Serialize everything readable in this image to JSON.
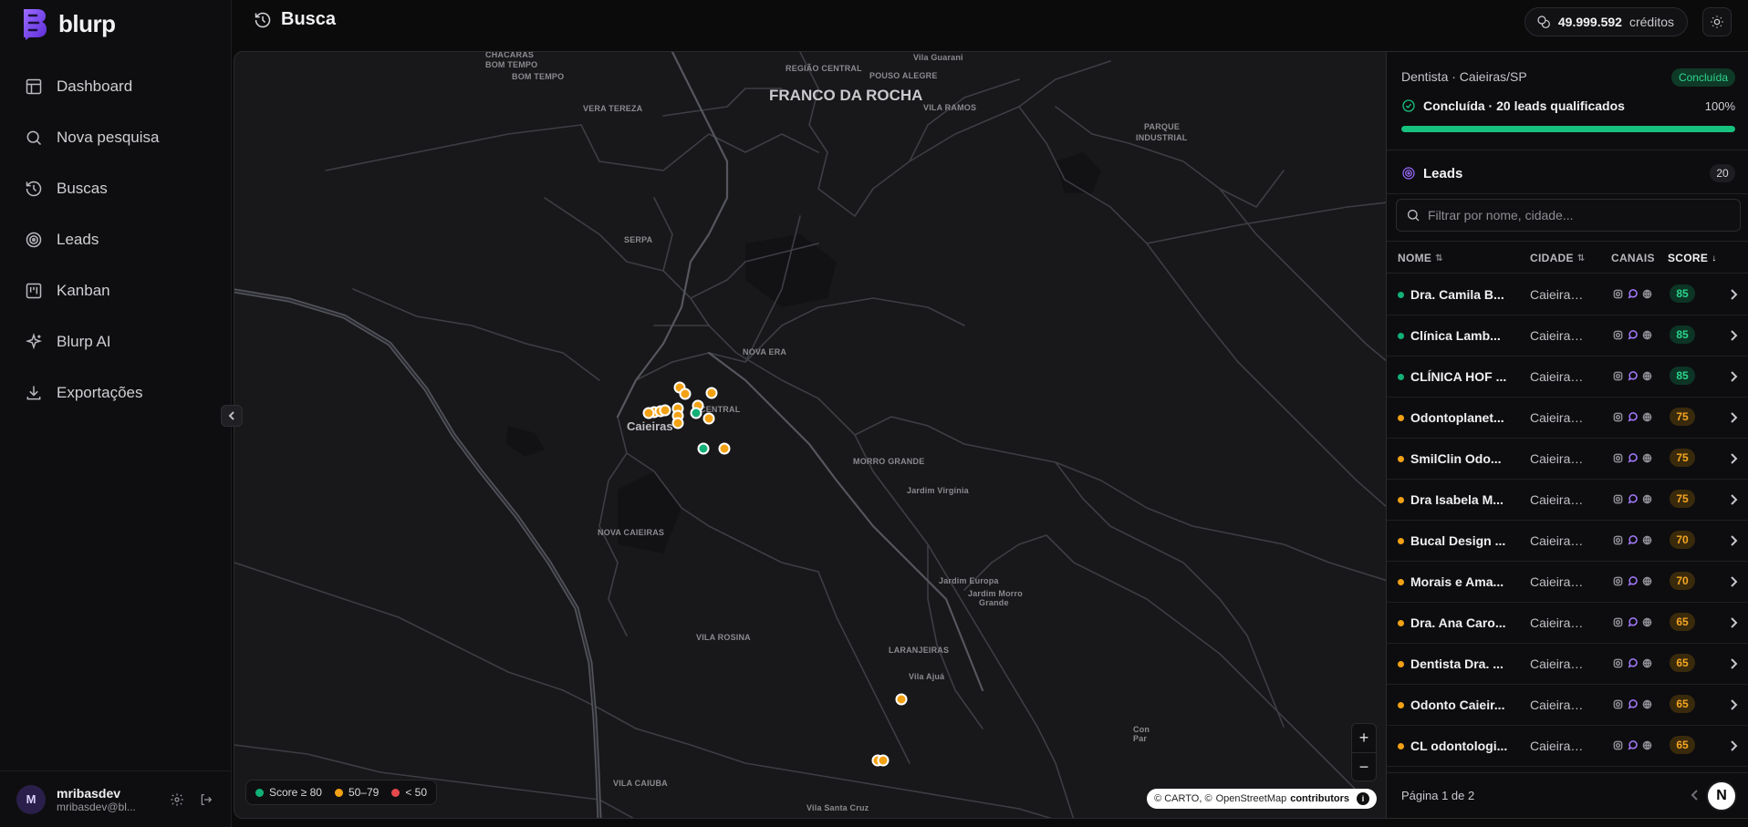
{
  "app": {
    "name": "blurp"
  },
  "sidebar": {
    "items": [
      {
        "label": "Dashboard",
        "icon": "dashboard-icon"
      },
      {
        "label": "Nova pesquisa",
        "icon": "search-icon"
      },
      {
        "label": "Buscas",
        "icon": "history-icon"
      },
      {
        "label": "Leads",
        "icon": "target-icon"
      },
      {
        "label": "Kanban",
        "icon": "kanban-icon"
      },
      {
        "label": "Blurp AI",
        "icon": "sparkles-icon"
      },
      {
        "label": "Exportações",
        "icon": "download-icon"
      }
    ]
  },
  "user": {
    "initial": "M",
    "name": "mribasdev",
    "email": "mribasdev@bl..."
  },
  "header": {
    "title": "Busca",
    "credits_amount": "49.999.592",
    "credits_label": "créditos"
  },
  "map": {
    "labels_large": [
      "FRANCO DA ROCHA"
    ],
    "labels_medium": [
      "Caieiras"
    ],
    "labels_small": [
      "CHÁCARAS",
      "BOM TEMPO",
      "BOM TEMPO",
      "VERA TEREZA",
      "REGIÃO CENTRAL",
      "POUSO ALEGRE",
      "Vila Guarani",
      "VILA RAMOS",
      "PARQUE",
      "INDUSTRIAL",
      "SERPA",
      "NOVA ERA",
      "CENTRAL",
      "MORRO GRANDE",
      "Jardim Virgínia",
      "NOVA CAIEIRAS",
      "Jardim Europa",
      "Jardim Morro",
      "Grande",
      "VILA ROSINA",
      "LARANJEIRAS",
      "Vila Ajuá",
      "VILA CAIUBA",
      "Vila Santa Cruz",
      "Con",
      "Par"
    ],
    "legend": [
      {
        "label": "Score ≥ 80",
        "color": "#12b076"
      },
      {
        "label": "50–79",
        "color": "#f3a114"
      },
      {
        "label": "< 50",
        "color": "#e5484d"
      }
    ],
    "zoom_in": "+",
    "zoom_out": "−",
    "attribution": {
      "carto": "© CARTO, ©",
      "osm": "OpenStreetMap",
      "contributors": "contributors",
      "info": "i"
    }
  },
  "panel": {
    "search_meta": "Dentista · Caieiras/SP",
    "status_badge": "Concluída",
    "progress_text": "Concluída · 20 leads qualificados",
    "progress_pct": "100%",
    "progress_value": 1.0,
    "leads_title": "Leads",
    "leads_count": "20",
    "filter_placeholder": "Filtrar por nome, cidade...",
    "columns": {
      "name": "NOME",
      "city": "CIDADE",
      "channels": "CANAIS",
      "score": "SCORE"
    },
    "rows": [
      {
        "name": "Dra. Camila B...",
        "city": "Caieiras/SP",
        "score": "85",
        "level": "hi"
      },
      {
        "name": "Clínica Lamb...",
        "city": "Caieiras/SP",
        "score": "85",
        "level": "hi"
      },
      {
        "name": "CLÍNICA HOF ...",
        "city": "Caieiras/SP",
        "score": "85",
        "level": "hi"
      },
      {
        "name": "Odontoplanet...",
        "city": "Caieiras/SP",
        "score": "75",
        "level": "mid"
      },
      {
        "name": "SmilClin Odo...",
        "city": "Caieiras/SP",
        "score": "75",
        "level": "mid"
      },
      {
        "name": "Dra Isabela M...",
        "city": "Caieiras/SP",
        "score": "75",
        "level": "mid"
      },
      {
        "name": "Bucal Design ...",
        "city": "Caieiras/SP",
        "score": "70",
        "level": "mid"
      },
      {
        "name": "Morais e Ama...",
        "city": "Caieiras/SP",
        "score": "70",
        "level": "mid"
      },
      {
        "name": "Dra. Ana Caro...",
        "city": "Caieiras/SP",
        "score": "65",
        "level": "mid"
      },
      {
        "name": "Dentista Dra. ...",
        "city": "Caieiras/SP",
        "score": "65",
        "level": "mid"
      },
      {
        "name": "Odonto Caieir...",
        "city": "Caieiras/SP",
        "score": "65",
        "level": "mid"
      },
      {
        "name": "CL odontologi...",
        "city": "Caieiras/SP",
        "score": "65",
        "level": "mid"
      }
    ],
    "pager_text": "Página 1 de 2",
    "n_badge": "N"
  },
  "colors": {
    "brand": "#7c4dff",
    "high": "#12b076",
    "mid": "#f3a114",
    "low": "#e5484d"
  }
}
